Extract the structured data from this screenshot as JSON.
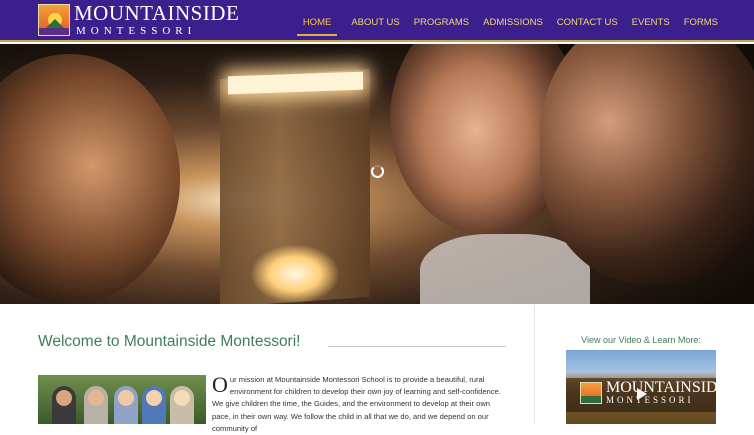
{
  "header": {
    "logo_title": "MOUNTAINSIDE",
    "logo_subtitle": "MONTESSORI",
    "nav": [
      {
        "label": "HOME",
        "active": true
      },
      {
        "label": "ABOUT US"
      },
      {
        "label": "PROGRAMS"
      },
      {
        "label": "ADMISSIONS"
      },
      {
        "label": "CONTACT US"
      },
      {
        "label": "EVENTS"
      },
      {
        "label": "FORMS"
      }
    ]
  },
  "main": {
    "welcome_title": "Welcome to Mountainside Montessori!",
    "mission_drop_cap": "O",
    "mission_text": "ur mission at Mountainside Montessori School is to provide a beautiful, rural environment for children to develop their own joy of learning and self-confidence. We give children the time, the Guides, and the environment to develop at their own pace, in their own way. We follow the child in all that we do, and we depend on our community of"
  },
  "sidebar": {
    "video_caption": "View our Video & Learn More:",
    "video_logo_title": "MOUNTAINSIDE",
    "video_logo_subtitle": "MONTESSORI"
  },
  "colors": {
    "header_bg": "#3b1f8c",
    "nav_text": "#f1d776",
    "accent_green": "#3f7d5a"
  }
}
